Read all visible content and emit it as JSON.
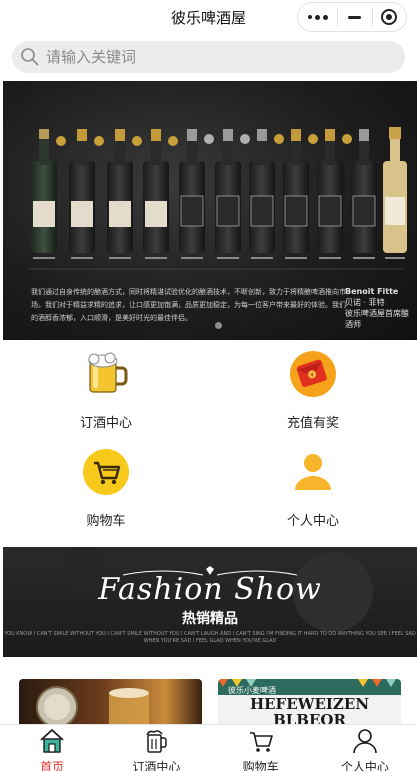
{
  "app": {
    "title": "彼乐啤酒屋"
  },
  "capsule": {
    "more_icon": "more-dots-icon",
    "minimize_icon": "minimize-icon",
    "close_icon": "target-close-icon"
  },
  "search": {
    "placeholder": "请输入关键词",
    "value": "",
    "icon": "search-icon"
  },
  "banner": {
    "caption": "我们通过自身传统的酿酒方式，同时将精湛试验优化的酿酒技术，不断创新，致力于将精酿啤酒推向市场。我们对于精益求精的追求，让口感更加饱满，品质更加稳定，为每一位客户带来最好的体验。我们的酒醇香浓郁，入口顺滑，是美好时光的最佳伴侣。",
    "signature_name": "Benoit Fitte",
    "signature_cn": "贝诺 · 菲特",
    "signature_role": "彼乐啤酒屋首席酿酒师",
    "active_slide": 1,
    "slide_count": 1
  },
  "grid": [
    {
      "id": "order",
      "label": "订酒中心",
      "icon": "beer-mug-icon"
    },
    {
      "id": "recharge",
      "label": "充值有奖",
      "icon": "red-envelope-icon"
    },
    {
      "id": "cart",
      "label": "购物车",
      "icon": "shopping-cart-icon"
    },
    {
      "id": "profile",
      "label": "个人中心",
      "icon": "user-icon"
    }
  ],
  "fashion": {
    "title": "Fashion Show",
    "subtitle": "热销精品",
    "lyric": "YOU KNOW I CAN'T SMILE WITHOUT YOU I CAN'T SMILE WITHOUT YOU I CAN'T LAUGH AND I CAN'T SING I'M FINDING IT HARD TO DO ANYTHING YOU SEE I FEEL SAD WHEN YOU'RE SAD I FEEL GLAD WHEN YOU'RE GLAD"
  },
  "cards": [
    {
      "id": "card-1"
    },
    {
      "id": "card-2",
      "line1": "彼乐小麦啤酒",
      "line2": "HEFEWEIZEN BLBEOR"
    }
  ],
  "tabbar": [
    {
      "id": "home",
      "label": "首页",
      "icon": "home-icon",
      "active": true
    },
    {
      "id": "order",
      "label": "订酒中心",
      "icon": "beer-icon",
      "active": false
    },
    {
      "id": "cart",
      "label": "购物车",
      "icon": "cart-icon",
      "active": false
    },
    {
      "id": "profile",
      "label": "个人中心",
      "icon": "person-icon",
      "active": false
    }
  ],
  "colors": {
    "accent": "#d9342b",
    "home_icon_fill": "#3bb39d",
    "search_bg": "#ececec"
  }
}
